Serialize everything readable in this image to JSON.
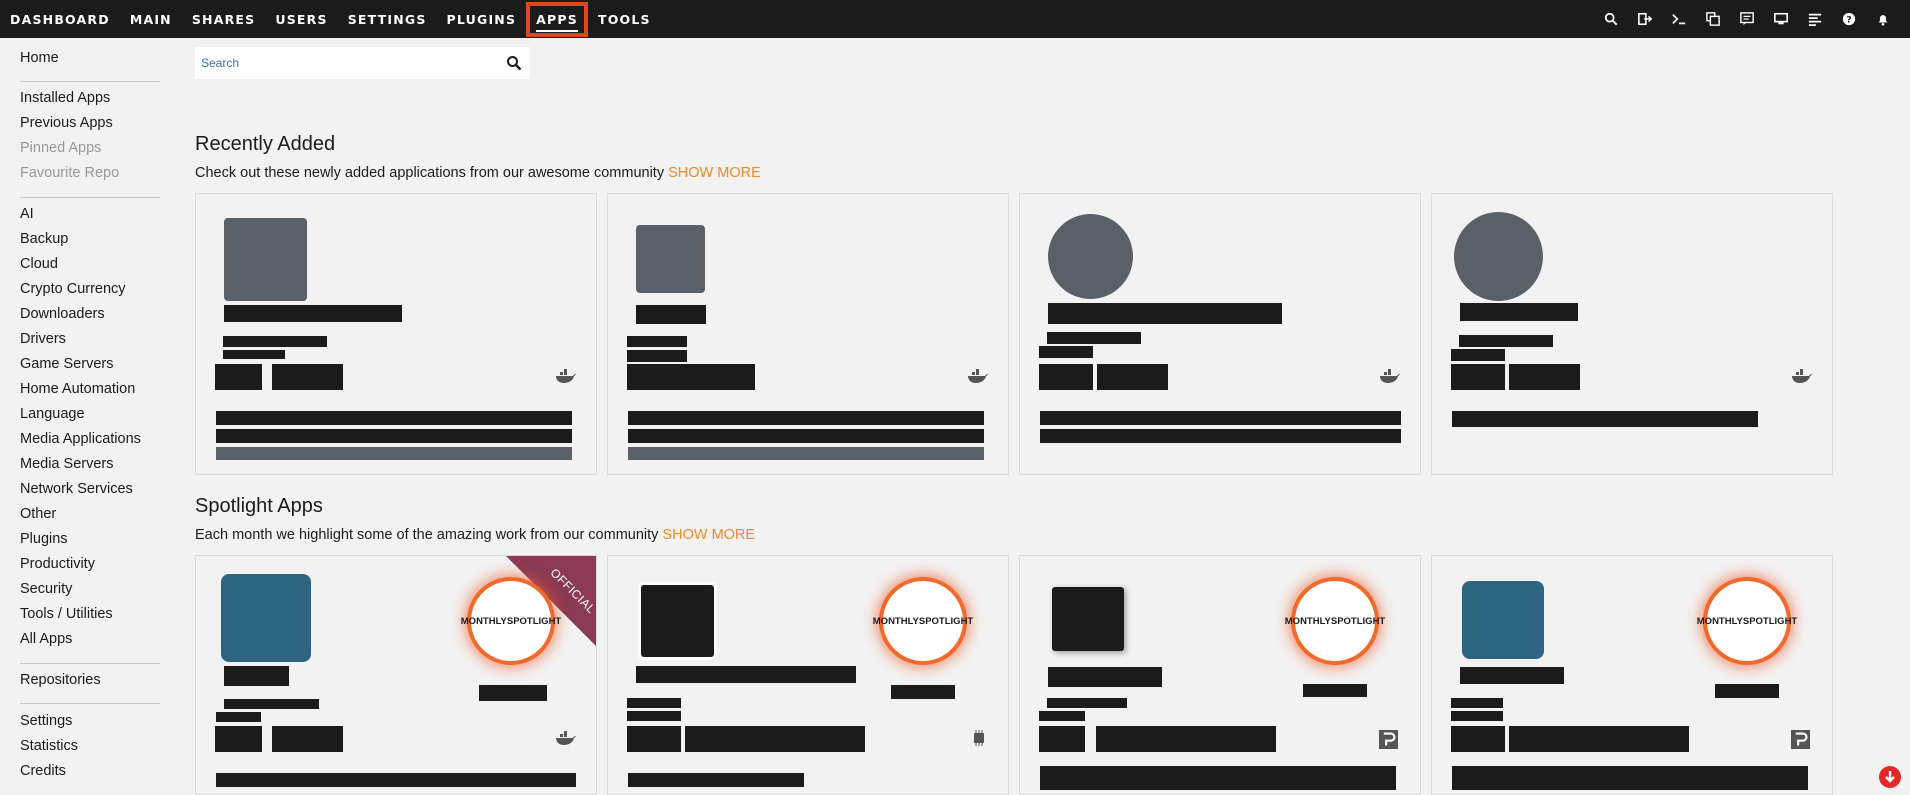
{
  "nav": {
    "items": [
      "DASHBOARD",
      "MAIN",
      "SHARES",
      "USERS",
      "SETTINGS",
      "PLUGINS",
      "APPS",
      "TOOLS"
    ],
    "active": "APPS"
  },
  "toolbar_icons": [
    "search-icon",
    "logout-icon",
    "terminal-icon",
    "copy-icon",
    "feedback-icon",
    "monitor-icon",
    "log-icon",
    "help-icon",
    "bell-icon"
  ],
  "sidebar": {
    "home": "Home",
    "group1": [
      "Installed Apps",
      "Previous Apps",
      "Pinned Apps",
      "Favourite Repo"
    ],
    "categories": [
      "AI",
      "Backup",
      "Cloud",
      "Crypto Currency",
      "Downloaders",
      "Drivers",
      "Game Servers",
      "Home Automation",
      "Language",
      "Media Applications",
      "Media Servers",
      "Network Services",
      "Other",
      "Plugins",
      "Productivity",
      "Security",
      "Tools / Utilities",
      "All Apps"
    ],
    "repositories": "Repositories",
    "group3": [
      "Settings",
      "Statistics",
      "Credits"
    ]
  },
  "search": {
    "placeholder": "Search"
  },
  "recent": {
    "title": "Recently Added",
    "subtitle": "Check out these newly added applications from our awesome community",
    "show_more": "SHOW MORE"
  },
  "spotlight": {
    "title": "Spotlight Apps",
    "subtitle": "Each month we highlight some of the amazing work from our community",
    "show_more": "SHOW MORE",
    "badge_line1": "MONTHLY",
    "badge_line2": "SPOTLIGHT",
    "ribbon": "OFFICIAL"
  },
  "colors": {
    "accent": "#f08a24",
    "nav_bg": "#1c1b1b",
    "highlight": "#e2461a",
    "ribbon": "#8a3a55",
    "teal_icon": "#2c6580"
  }
}
